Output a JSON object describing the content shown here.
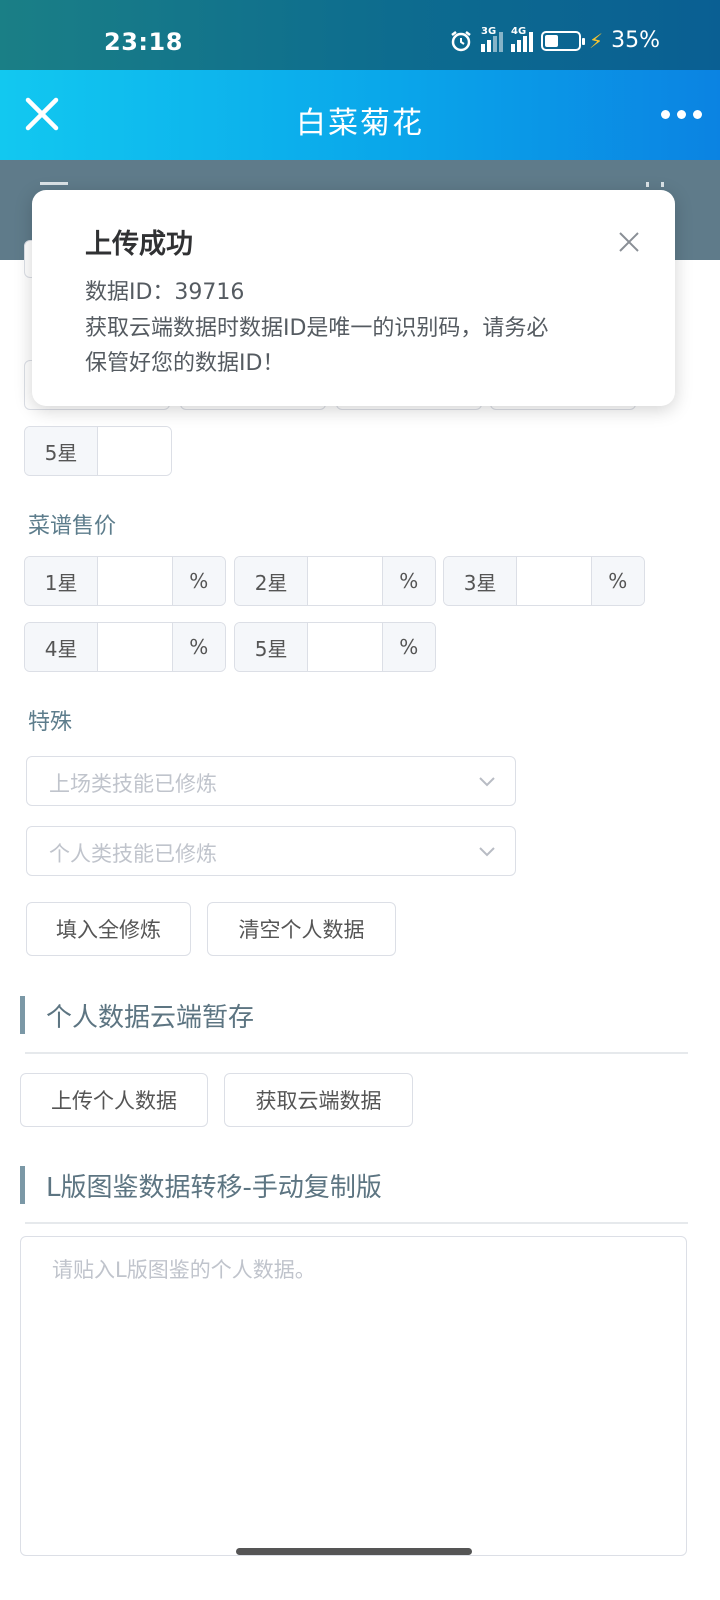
{
  "status_bar": {
    "time": "23:18",
    "battery_text": "35%",
    "battery_level": 0.35,
    "icons": [
      "alarm-icon",
      "signal-3g-icon",
      "signal-4g-icon",
      "battery-icon",
      "charging-icon"
    ],
    "net1": "3G",
    "net2": "4G"
  },
  "title_bar": {
    "title": "白菜菊花",
    "close_icon": "close-icon",
    "more_icon": "more-icon"
  },
  "toast": {
    "title": "上传成功",
    "id_line": "数据ID：39716",
    "message_line1": "获取云端数据时数据ID是唯一的识别码，请务必",
    "message_line2": "保管好您的数据ID！"
  },
  "partial_row": {
    "label": "5星"
  },
  "price_section": {
    "label": "菜谱售价",
    "items": [
      {
        "prefix": "1星",
        "suffix": "%"
      },
      {
        "prefix": "2星",
        "suffix": "%"
      },
      {
        "prefix": "3星",
        "suffix": "%"
      },
      {
        "prefix": "4星",
        "suffix": "%"
      },
      {
        "prefix": "5星",
        "suffix": "%"
      }
    ]
  },
  "special": {
    "label": "特殊",
    "select1_placeholder": "上场类技能已修炼",
    "select2_placeholder": "个人类技能已修炼",
    "fill_button": "填入全修炼",
    "clear_button": "清空个人数据"
  },
  "cloud": {
    "heading": "个人数据云端暂存",
    "upload_button": "上传个人数据",
    "fetch_button": "获取云端数据"
  },
  "transfer": {
    "heading": "L版图鉴数据转移-手动复制版",
    "textarea_placeholder": "请贴入L版图鉴的个人数据。"
  },
  "colors": {
    "title_bar_gradient_start": "#12c8f0",
    "title_bar_gradient_end": "#0b83e2",
    "section_label": "#5d7d8c",
    "border": "#dcdfe6"
  }
}
